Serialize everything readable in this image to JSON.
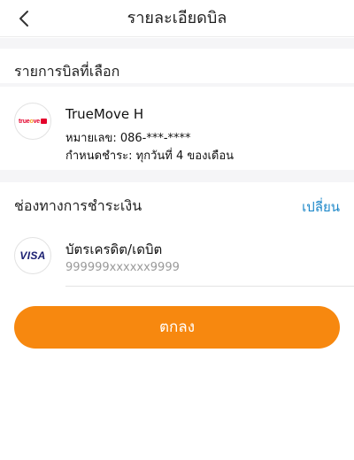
{
  "header": {
    "title": "รายละเอียดบิล",
    "back_icon": "chevron-left-icon"
  },
  "bill_section": {
    "title": "รายการบิลที่เลือก",
    "item": {
      "logo": "truemove-h-logo",
      "logo_text_a": "true",
      "logo_text_o": "o",
      "logo_text_b": "ve",
      "name": "TrueMove H",
      "number_line": "หมายเลข: 086-***-****",
      "due_line": "กำหนดชำระ: ทุกวันที่ 4 ของเดือน"
    }
  },
  "payment_section": {
    "title": "ช่องทางการชำระเงิน",
    "change_label": "เปลี่ยน",
    "method": {
      "logo": "visa-logo",
      "logo_text": "VISA",
      "label": "บัตรเครดิต/เดบิต",
      "card_number": "999999xxxxxx9999"
    }
  },
  "confirm_button": {
    "label": "ตกลง"
  },
  "colors": {
    "accent_orange": "#f7880f",
    "link_blue": "#1e88c9",
    "separator_gray": "#f5f5f7",
    "visa_blue": "#1a1f71",
    "true_red": "#e4002b"
  }
}
